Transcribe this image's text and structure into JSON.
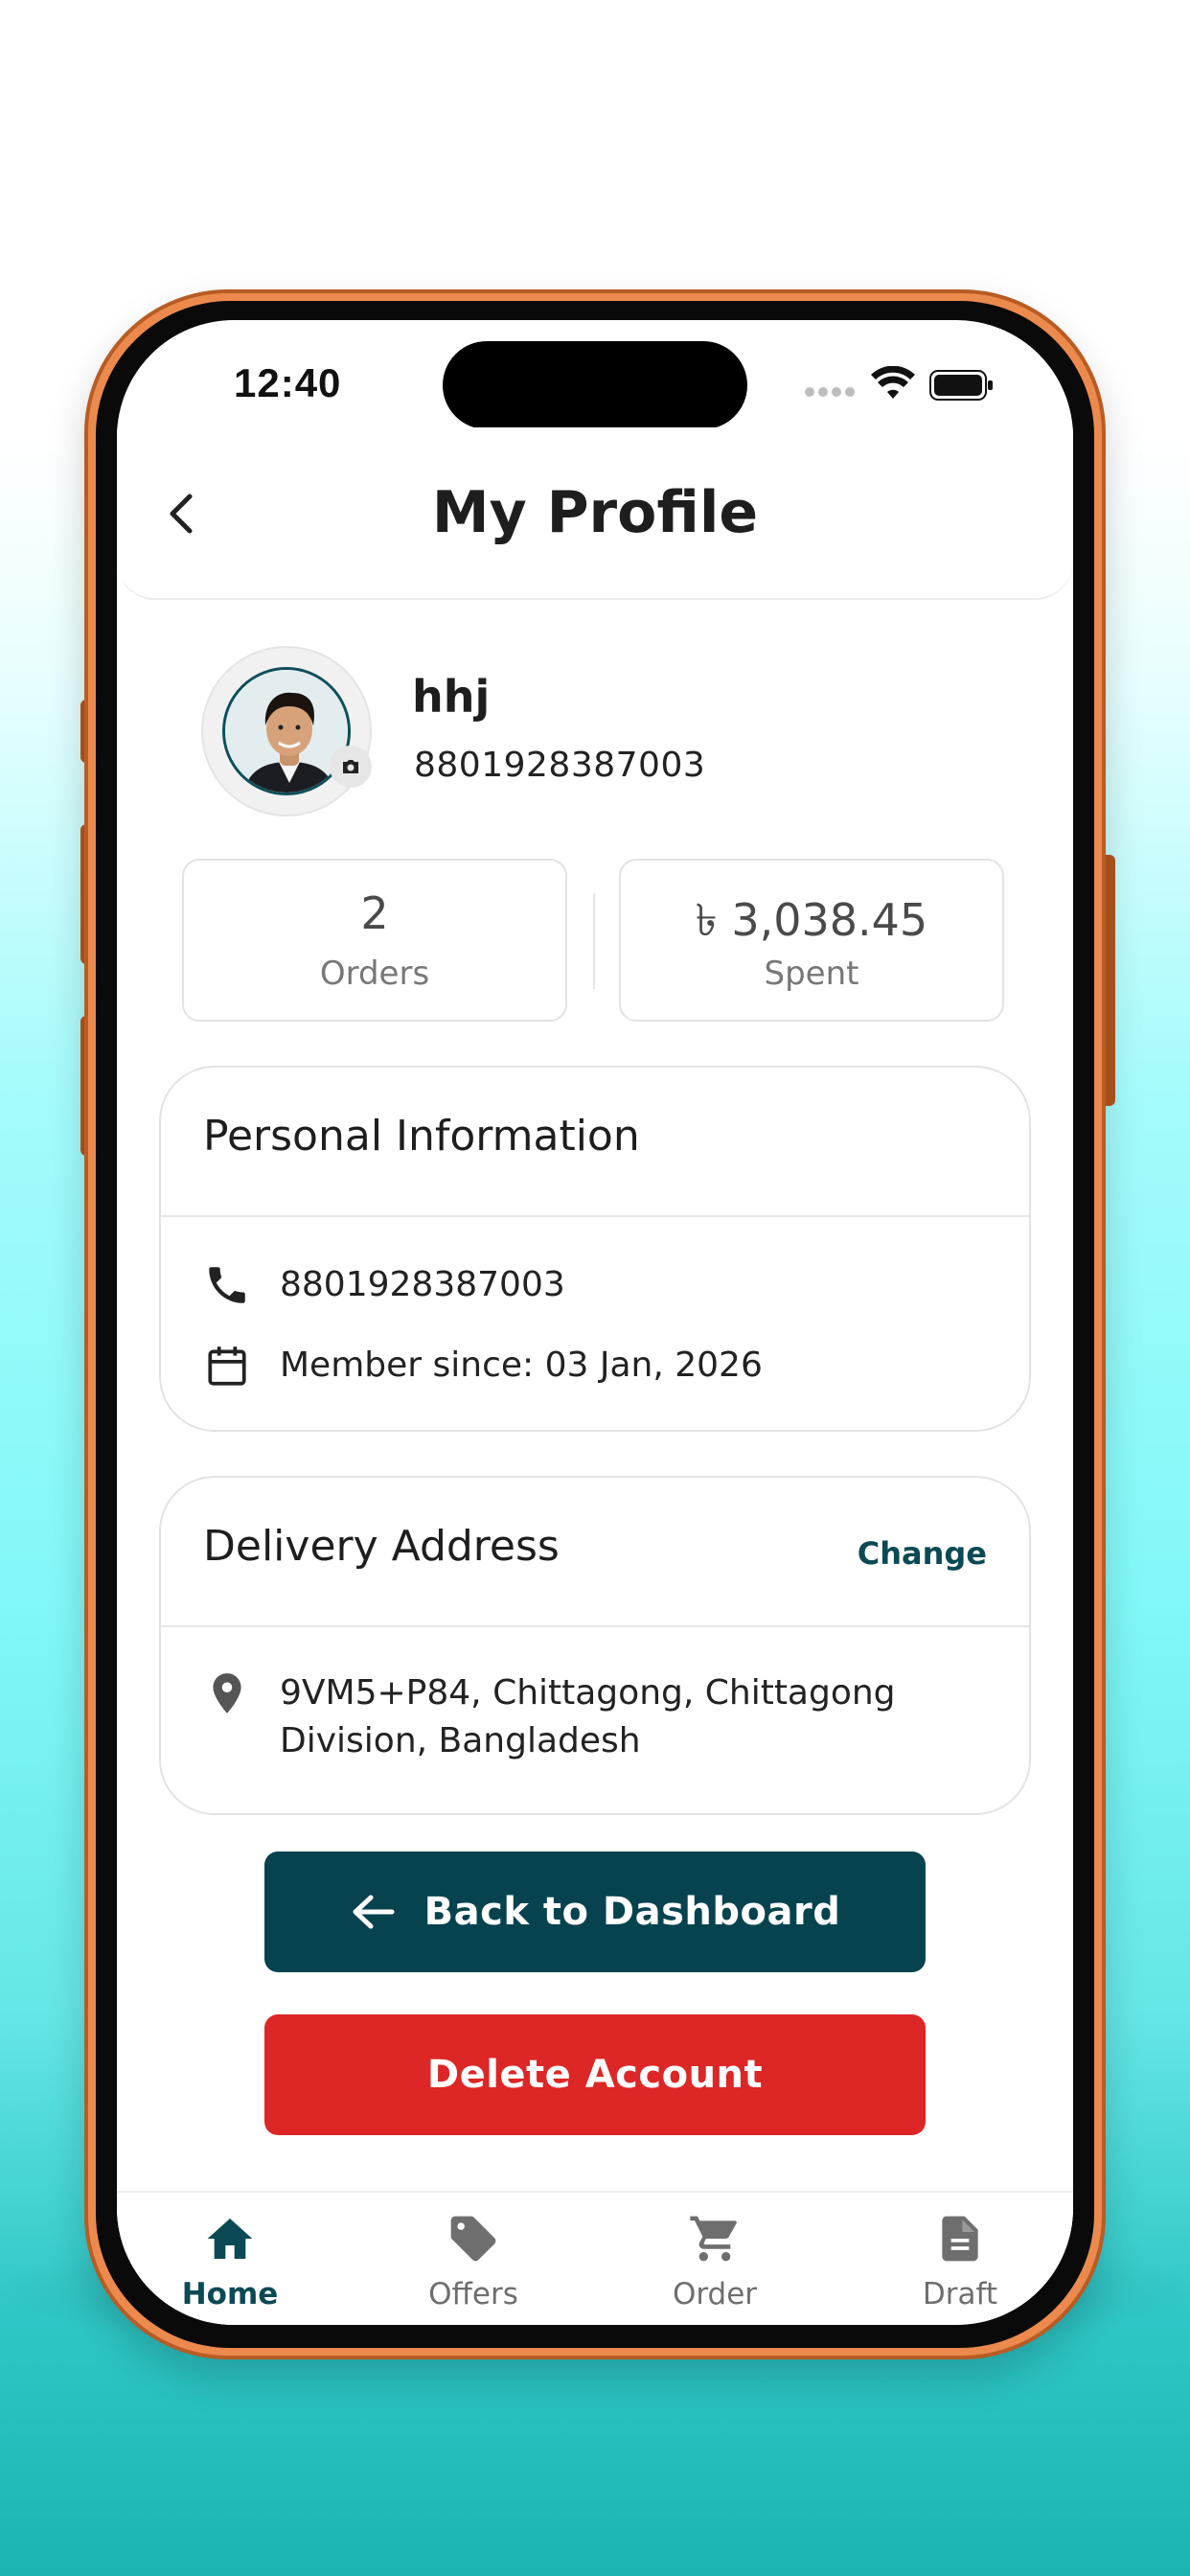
{
  "status_bar": {
    "time": "12:40"
  },
  "header": {
    "title": "My Profile",
    "back_icon": "chevron-left-icon"
  },
  "profile": {
    "name": "hhj",
    "phone": "8801928387003",
    "camera_icon": "camera-icon"
  },
  "stats": {
    "orders": {
      "value": "2",
      "label": "Orders"
    },
    "spent": {
      "value": "৳ 3,038.45",
      "label": "Spent"
    }
  },
  "personal_info": {
    "title": "Personal Information",
    "phone": "8801928387003",
    "member_since": "Member since: 03 Jan, 2026",
    "phone_icon": "phone-icon",
    "calendar_icon": "calendar-icon"
  },
  "delivery_address": {
    "title": "Delivery Address",
    "change_label": "Change",
    "address_line1": "9VM5+P84, Chittagong, Chittagong",
    "address_line2": "Division, Bangladesh",
    "location_icon": "location-pin-icon"
  },
  "actions": {
    "back_label": "Back to Dashboard",
    "delete_label": "Delete Account"
  },
  "bottom_nav": {
    "items": [
      {
        "label": "Home",
        "icon": "home-icon",
        "active": true
      },
      {
        "label": "Offers",
        "icon": "tag-icon",
        "active": false
      },
      {
        "label": "Order",
        "icon": "cart-icon",
        "active": false
      },
      {
        "label": "Draft",
        "icon": "document-icon",
        "active": false
      }
    ]
  },
  "colors": {
    "primary": "#06434f",
    "danger": "#dd2626",
    "frame": "#ec8a4e",
    "background_top": "#ffffff",
    "background_bottom": "#1db3b3"
  }
}
